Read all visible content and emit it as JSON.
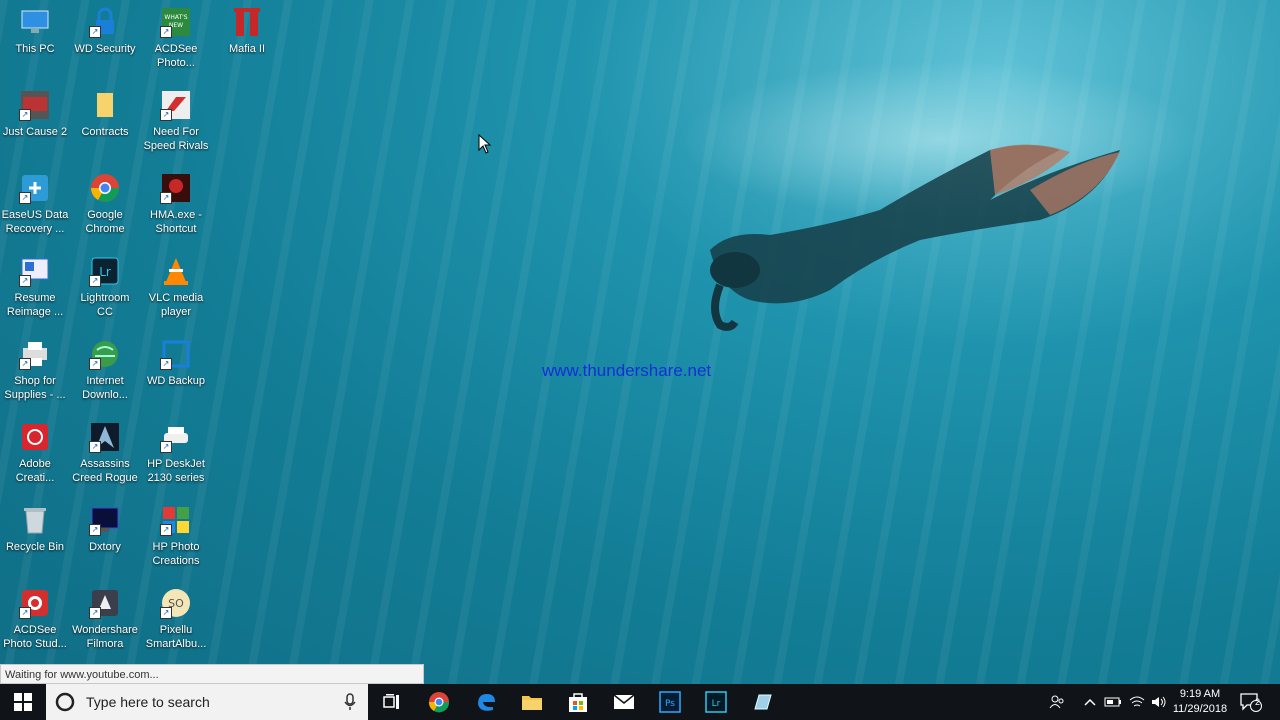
{
  "desktop": {
    "icons": [
      {
        "label": "This PC"
      },
      {
        "label": "WD Security"
      },
      {
        "label": "ACDSee\nPhoto..."
      },
      {
        "label": "Mafia II"
      },
      {
        "label": "Just Cause 2"
      },
      {
        "label": "Contracts"
      },
      {
        "label": "Need For\nSpeed Rivals"
      },
      {
        "label": "EaseUS Data\nRecovery ..."
      },
      {
        "label": "Google\nChrome"
      },
      {
        "label": "HMA.exe -\nShortcut"
      },
      {
        "label": "Resume\nReimage ..."
      },
      {
        "label": "Lightroom\nCC"
      },
      {
        "label": "VLC media\nplayer"
      },
      {
        "label": "Shop for\nSupplies - ..."
      },
      {
        "label": "Internet\nDownlo..."
      },
      {
        "label": "WD Backup"
      },
      {
        "label": "Adobe\nCreati..."
      },
      {
        "label": "Assassins\nCreed Rogue"
      },
      {
        "label": "HP DeskJet\n2130 series"
      },
      {
        "label": "Recycle Bin"
      },
      {
        "label": "Dxtory"
      },
      {
        "label": "HP Photo\nCreations"
      },
      {
        "label": "ACDSee\nPhoto Stud..."
      },
      {
        "label": "Wondershare\nFilmora"
      },
      {
        "label": "Pixellu\nSmartAlbu..."
      }
    ],
    "watermark": "www.thundershare.net"
  },
  "browser_status": "Waiting for www.youtube.com...",
  "taskbar": {
    "search_placeholder": "Type here to search",
    "apps": [
      "chrome",
      "edge",
      "file-explorer",
      "store",
      "mail",
      "photoshop",
      "lightroom",
      "notepad"
    ],
    "clock": {
      "time": "9:19 AM",
      "date": "11/29/2018"
    },
    "notification_count": "2"
  },
  "colors": {
    "taskbar": "#101318",
    "water": "#137d96",
    "watermark": "#1030d8"
  }
}
